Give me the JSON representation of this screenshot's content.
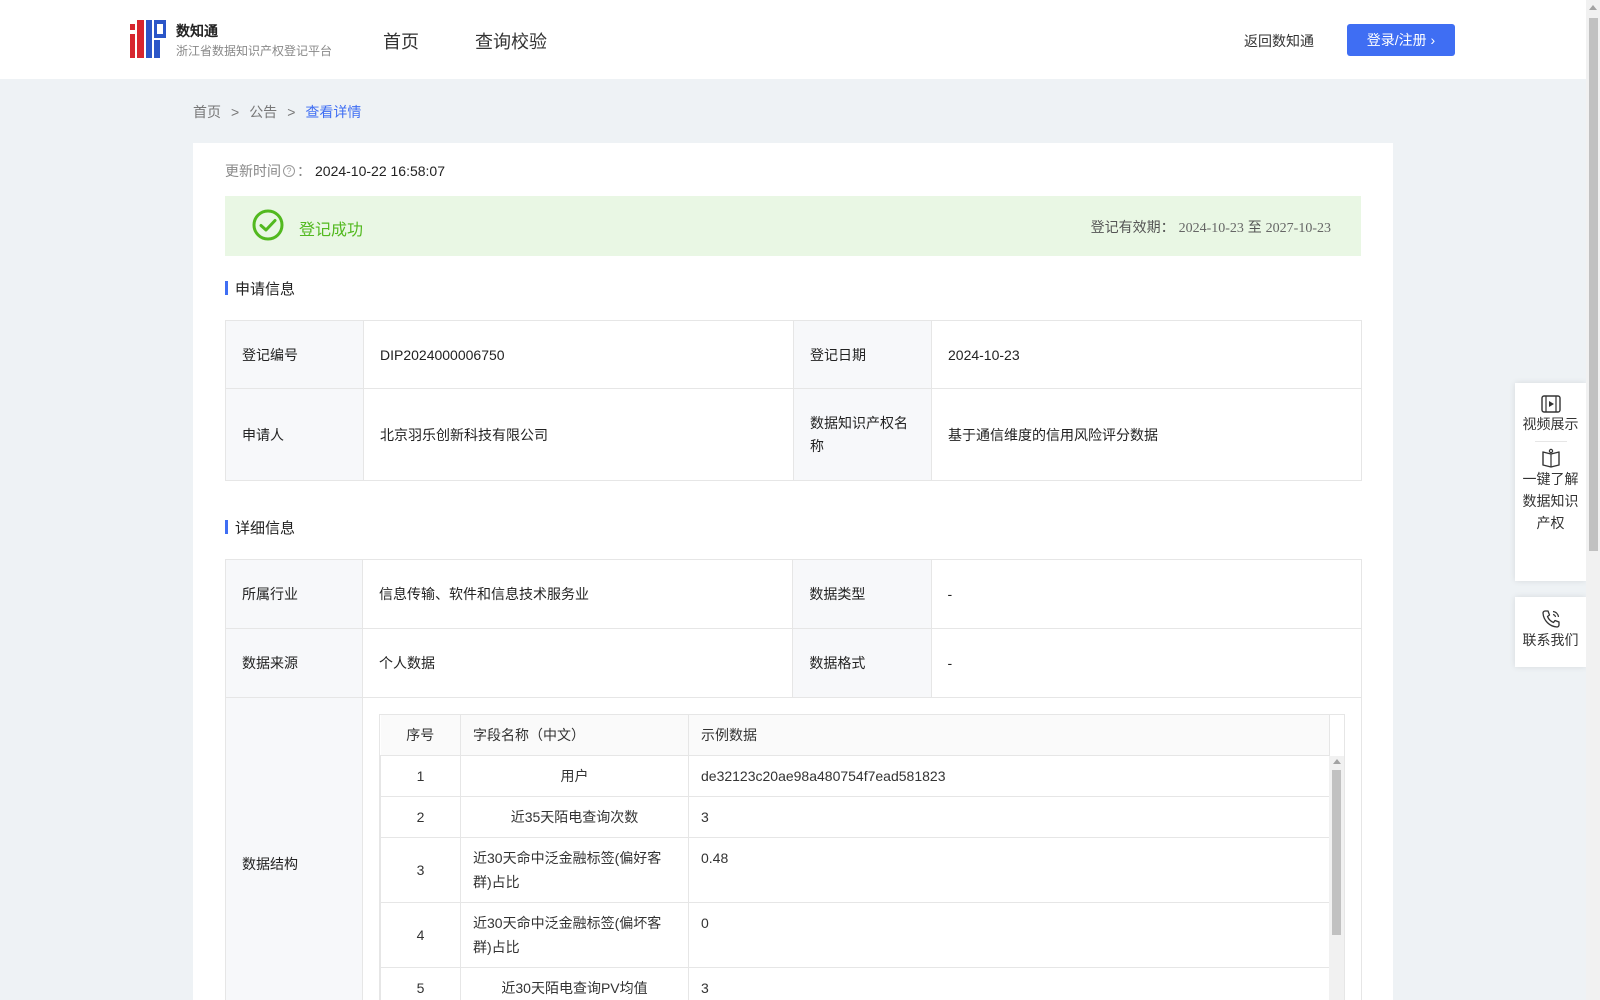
{
  "brand": {
    "name": "数知通",
    "subtitle": "浙江省数据知识产权登记平台"
  },
  "nav": {
    "items": [
      "首页",
      "查询校验"
    ],
    "back_label": "返回数知通",
    "login_label": "登录/注册 ›"
  },
  "breadcrumb": {
    "home": "首页",
    "sep": ">",
    "notice": "公告",
    "current": "查看详情"
  },
  "update": {
    "label": "更新时间",
    "colon": "：",
    "value": "2024-10-22 16:58:07"
  },
  "status": {
    "text": "登记成功",
    "validity_label": "登记有效期：",
    "validity_start": "2024-10-23",
    "validity_to": "至",
    "validity_end": "2027-10-23",
    "color": "#52b91f"
  },
  "application": {
    "title": "申请信息",
    "reg_no_label": "登记编号",
    "reg_no": "DIP2024000006750",
    "reg_date_label": "登记日期",
    "reg_date": "2024-10-23",
    "applicant_label": "申请人",
    "applicant": "北京羽乐创新科技有限公司",
    "ip_name_label": "数据知识产权名称",
    "ip_name": "基于通信维度的信用风险评分数据"
  },
  "detail": {
    "title": "详细信息",
    "industry_label": "所属行业",
    "industry": "信息传输、软件和信息技术服务业",
    "data_type_label": "数据类型",
    "data_type": "-",
    "source_label": "数据来源",
    "source": "个人数据",
    "format_label": "数据格式",
    "format": "-",
    "structure_label": "数据结构",
    "structure": {
      "headers": [
        "序号",
        "字段名称（中文）",
        "示例数据"
      ],
      "rows": [
        {
          "no": "1",
          "field": "用户",
          "sample": "de32123c20ae98a480754f7ead581823"
        },
        {
          "no": "2",
          "field": "近35天陌电查询次数",
          "sample": "3"
        },
        {
          "no": "3",
          "field": "近30天命中泛金融标签(偏好客群)占比",
          "sample": "0.48"
        },
        {
          "no": "4",
          "field": "近30天命中泛金融标签(偏坏客群)占比",
          "sample": "0"
        },
        {
          "no": "5",
          "field": "近30天陌电查询PV均值",
          "sample": "3"
        }
      ]
    }
  },
  "side_panel": {
    "video": "视频展示",
    "learn": "一键了解数据知识产权",
    "contact": "联系我们"
  },
  "accent": "#3f6ef3"
}
